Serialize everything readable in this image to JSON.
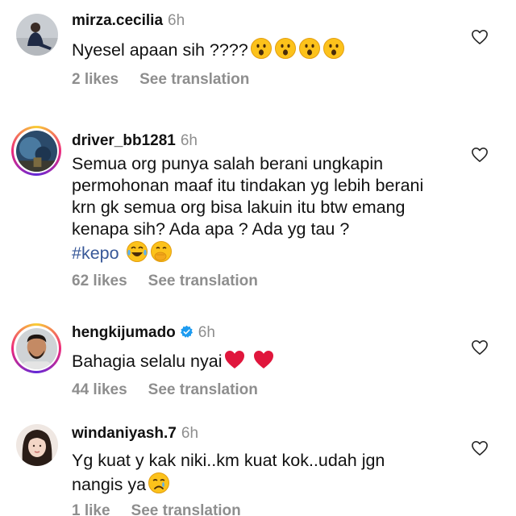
{
  "comments": [
    {
      "username": "mirza.cecilia",
      "time": "6h",
      "text": "Nyesel  apaan sih ????",
      "likes": "2 likes",
      "see_translation": "See translation",
      "emojis": [
        "hushed-face",
        "hushed-face",
        "hushed-face",
        "hushed-face"
      ]
    },
    {
      "username": "driver_bb1281",
      "time": "6h",
      "text": "Semua org punya salah berani ungkapin permohonan maaf itu tindakan yg lebih berani krn gk semua org bisa lakuin itu btw emang kenapa sih? Ada apa ? Ada yg tau ?",
      "hashtag": "#kepo",
      "likes": "62 likes",
      "see_translation": "See translation",
      "emojis": [
        "face-with-tears-of-joy",
        "face-with-hand-over-mouth"
      ]
    },
    {
      "username": "hengkijumado",
      "time": "6h",
      "verified": true,
      "text": "Bahagia selalu nyai",
      "likes": "44 likes",
      "see_translation": "See translation",
      "emojis": [
        "red-heart",
        "red-heart"
      ]
    },
    {
      "username": "windaniyash.7",
      "time": "6h",
      "text_line1": "Yg kuat y kak niki..km kuat kok..udah jgn",
      "text_line2": "nangis ya",
      "likes": "1 like",
      "see_translation": "See translation",
      "emojis": [
        "crying-face"
      ]
    }
  ],
  "colors": {
    "text": "#111111",
    "muted": "#8e8e8e",
    "hashtag": "#385898",
    "verified": "#1d9bf0",
    "heart_emoji": "#e0163c"
  },
  "icons": {
    "like": "heart-outline-icon",
    "verified": "verified-badge-icon"
  }
}
